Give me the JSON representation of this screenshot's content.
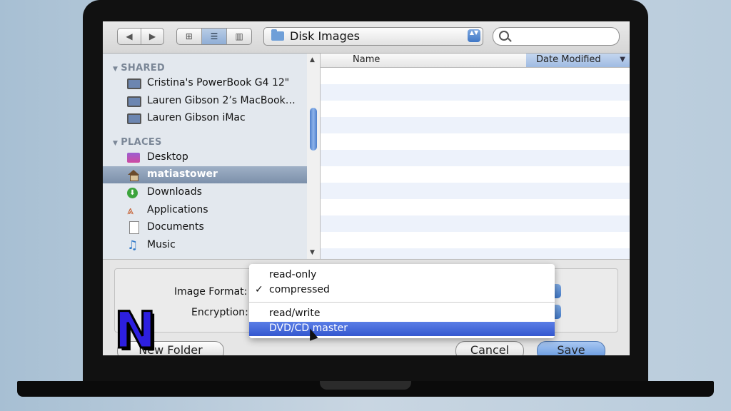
{
  "toolbar": {
    "back_icon": "◀",
    "forward_icon": "▶",
    "view_icon_grid": "⊞",
    "view_icon_list": "☰",
    "view_icon_columns": "▥",
    "location": "Disk Images",
    "location_stepper": "▲▼",
    "search_value": ""
  },
  "sidebar": {
    "shared_header": "SHARED",
    "shared_items": [
      {
        "label": "Cristina's PowerBook G4 12\"",
        "icon": "computer-icon"
      },
      {
        "label": "Lauren Gibson 2’s MacBook…",
        "icon": "computer-icon"
      },
      {
        "label": "Lauren Gibson iMac",
        "icon": "computer-icon"
      }
    ],
    "places_header": "PLACES",
    "places_items": [
      {
        "label": "Desktop",
        "icon": "desktop-icon"
      },
      {
        "label": "matiastower",
        "icon": "home-icon",
        "selected": true
      },
      {
        "label": "Downloads",
        "icon": "downloads-icon"
      },
      {
        "label": "Applications",
        "icon": "applications-icon"
      },
      {
        "label": "Documents",
        "icon": "documents-icon"
      },
      {
        "label": "Music",
        "icon": "music-icon"
      }
    ]
  },
  "file_list": {
    "col_name": "Name",
    "col_date": "Date Modified",
    "sort_indicator": "▼"
  },
  "options": {
    "image_format_label": "Image Format:",
    "encryption_label": "Encryption:"
  },
  "format_menu": {
    "items": [
      {
        "label": "read-only",
        "checked": false
      },
      {
        "label": "compressed",
        "checked": true
      },
      {
        "label": "read/write",
        "checked": false
      },
      {
        "label": "DVD/CD master",
        "highlighted": true
      }
    ],
    "check_mark": "✓"
  },
  "buttons": {
    "new_folder": "New Folder",
    "cancel": "Cancel",
    "save": "Save"
  },
  "logo": {
    "letter": "N",
    "color": "#2d1fe0"
  }
}
